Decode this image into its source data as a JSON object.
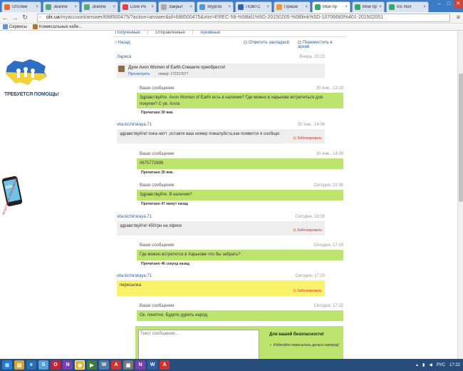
{
  "browser": {
    "tabs": [
      {
        "title": "Отслеж"
      },
      {
        "title": "Jeanne"
      },
      {
        "title": "Jeanne"
      },
      {
        "title": "Love Po"
      },
      {
        "title": "Закрыт"
      },
      {
        "title": "Wyprze"
      },
      {
        "title": "ПОВТС"
      },
      {
        "title": "Прише"
      },
      {
        "title": "Мой пр"
      },
      {
        "title": "Мой пр"
      },
      {
        "title": "Iris Noir"
      }
    ],
    "tab_close": "×",
    "url_host": "olx.ua",
    "url_path": "/myaccount/answer/688500475/?action=answer&id=688500475&xtor=EREC-58-%5Bid1%5D-20150205-%5Blink%5D-10706683%401-201502051",
    "bookmarks": [
      "Сервисы",
      "Комиксальные кабе..."
    ]
  },
  "promo": {
    "help_text": "ТРЕБУЕТСЯ ПОМОЩЬ!",
    "app_caption": "МОБИЛЬНОЕ ПРИЛОЖЕНИЕ",
    "app_logo": "olx"
  },
  "nav": {
    "tab_received": "Полученные",
    "tab_sent": "Отправленные",
    "tab_archive": "Архивные",
    "sep": "|",
    "back": "‹ Назад",
    "mark_bookmark": "Отметить закладкой",
    "move_archive": "Переместить в архив"
  },
  "conversation": {
    "first_sender": "Лариса",
    "first_time": "Вчера, 20:23",
    "item_title": "Духи Avon Women of Earth.Спешите приобрести!",
    "item_view": "Просмотреть",
    "item_number": "номер: 172317677",
    "block_label": "Заблокировать",
    "read_label": "Прочитано 30 янв.",
    "messages": [
      {
        "who": "Ваше сообщение",
        "when": "30 янв., 13:19",
        "text": "Здравствуйте. Avon Women of Earth есть в наличии? Где можно в харькове встретиться для покупки? С ув. Алла",
        "read": "Прочитано 30 янв."
      },
      {
        "who": "vita.kichirskaya.71",
        "when": "30 янв., 14:06",
        "text": "здравствуйте! пока нетт ,оставте ваш номер пожалуйста,как появится я сообщю"
      },
      {
        "who": "Ваше сообщение",
        "when": "30 янв., 14:09",
        "text": "0675772899",
        "read": "Прочитано 30 янв."
      },
      {
        "who": "Ваше сообщение",
        "when": "Сегодня, 15:38",
        "text": "Здравствуйте. В наличии?",
        "read": "Прочитано 47 минут назад"
      },
      {
        "who": "vita.kichirskaya.71",
        "when": "Сегодня, 16:33",
        "text": "здравствуйте! 450грн на офисе"
      },
      {
        "who": "Ваше сообщение",
        "when": "Сегодня, 17:19",
        "text": "Где можно встретится в Харькове что бы забрать?",
        "read": "Прочитано 46 секунд назад"
      },
      {
        "who": "vita.kichirskaya.71",
        "when": "Сегодня, 17:20",
        "text": "пересылка"
      },
      {
        "who": "Ваше сообщение",
        "when": "Сегодня, 17:22",
        "text": "Ок. понятно. Будете дурить народ."
      }
    ]
  },
  "reply": {
    "placeholder": "Текст сообщения....",
    "safety_title": "Для вашей безопасности!",
    "safety_text": "Избегайте пересылать деньги наперед!"
  },
  "taskbar": {
    "lang": "РУС",
    "time": "17:22"
  },
  "colors": {
    "my_message": "#bde46f",
    "their_message": "#eeeeee",
    "highlight": "#faf36a",
    "link": "#2f5f9a"
  }
}
